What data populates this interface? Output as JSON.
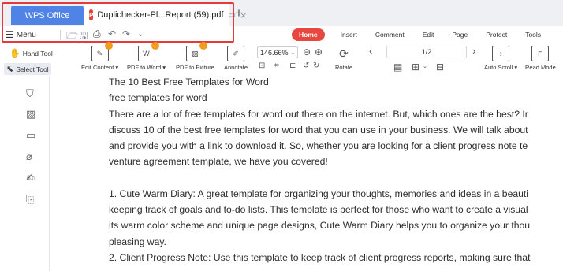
{
  "tabs": {
    "app_tab": "WPS Office",
    "doc_tab": {
      "badge": "P",
      "title": "Duplichecker-Pl...Report (59).pdf",
      "close": "×"
    },
    "new_tab": "+"
  },
  "menu": {
    "label": "Menu",
    "quick_access": [
      "open-folder-icon",
      "save-icon",
      "print-icon",
      "undo-icon",
      "redo-icon",
      "more-icon"
    ]
  },
  "ribbon_tabs": [
    "Home",
    "Insert",
    "Comment",
    "Edit",
    "Page",
    "Protect",
    "Tools"
  ],
  "toolbar": {
    "hand_tool": "Hand Tool",
    "select_tool": "Select Tool",
    "edit_content": "Edit Content",
    "pdf_to_word": "PDF to Word",
    "pdf_to_picture": "PDF to Picture",
    "annotate": "Annotate",
    "zoom": "146.66%",
    "rotate": "Rotate",
    "page_indicator": "1/2",
    "auto_scroll": "Auto Scroll",
    "read_mode": "Read Mode"
  },
  "colors": {
    "accent_blue": "#4f83e6",
    "accent_red": "#e6473f",
    "highlight_border": "#e43a3a"
  },
  "document": {
    "lines": [
      "The 10 Best Free Templates for Word",
      "free templates for word",
      "There are a lot of free templates for word out there on the internet. But, which ones are the best? Ir",
      "discuss 10 of the best free templates for word that you can use in your business. We will talk about",
      "and provide you with a link to download it. So, whether you are looking for a client progress note te",
      "venture agreement template, we have you covered!",
      "",
      "1. Cute Warm Diary: A great template for organizing your thoughts, memories and ideas in a beauti",
      "keeping track of goals and to-do lists. This template is perfect for those who want to create a visual",
      "its warm color scheme and unique page designs, Cute Warm Diary helps you to organize your thou",
      "pleasing way.",
      "2. Client Progress Note: Use this template to keep track of client progress reports, making sure that"
    ]
  }
}
